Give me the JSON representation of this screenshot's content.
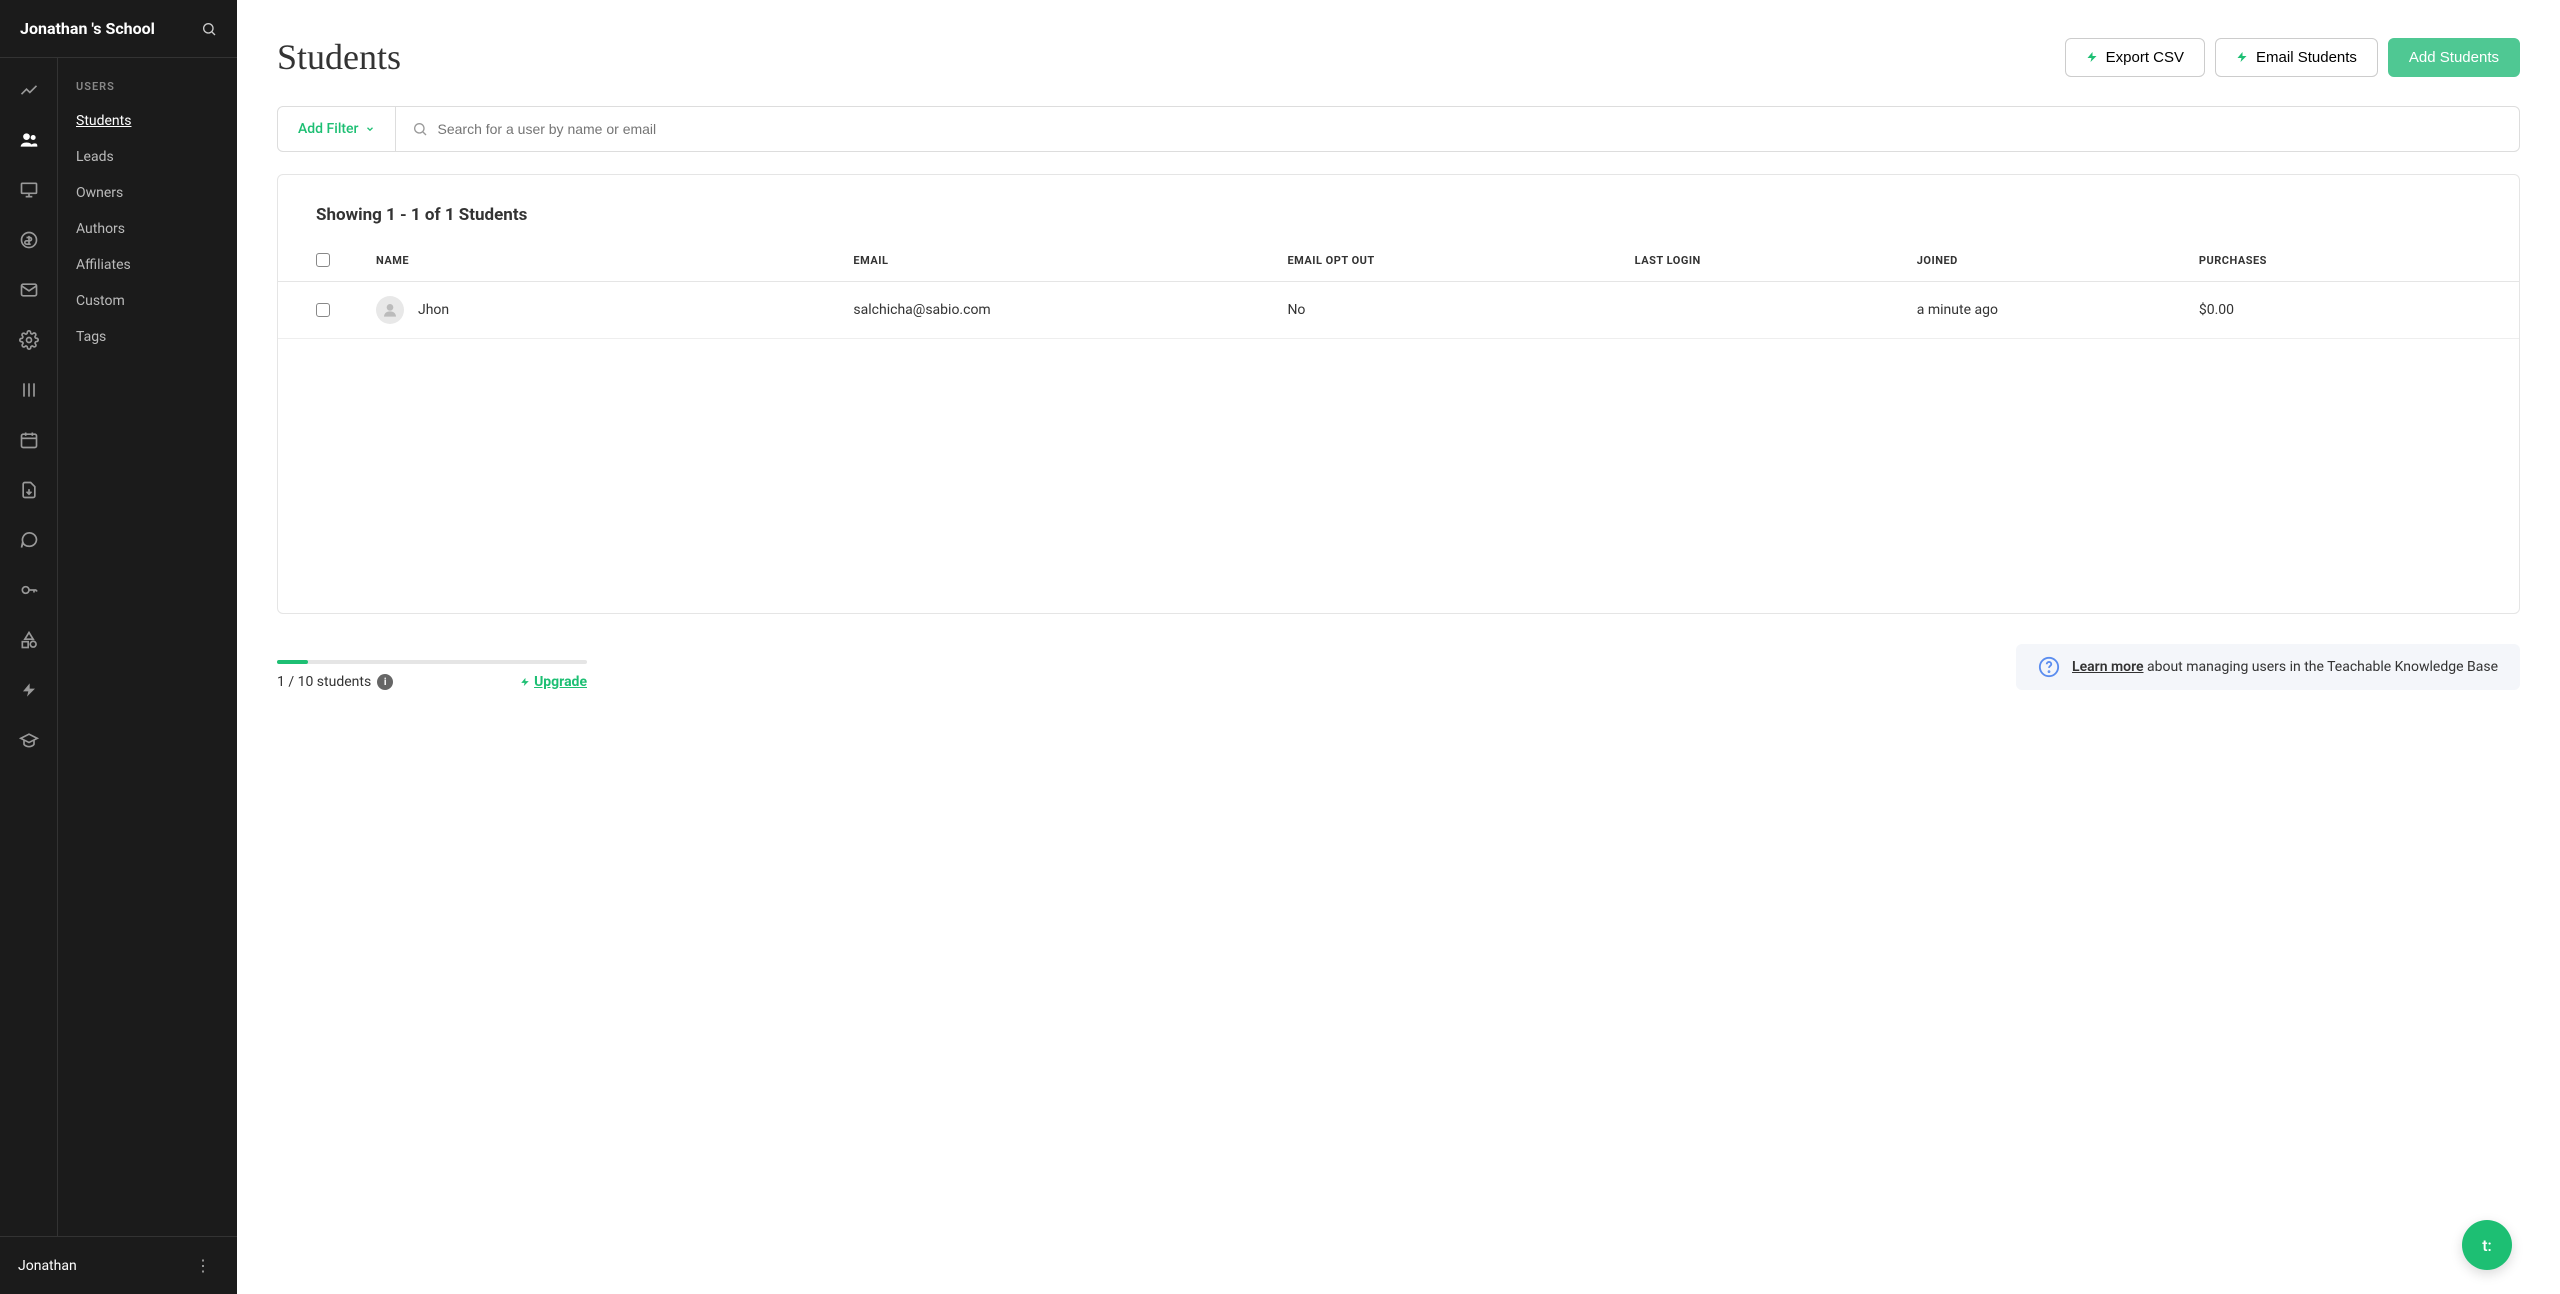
{
  "school_name": "Jonathan 's School",
  "subnav": {
    "heading": "USERS",
    "items": [
      "Students",
      "Leads",
      "Owners",
      "Authors",
      "Affiliates",
      "Custom",
      "Tags"
    ]
  },
  "user": {
    "name": "Jonathan"
  },
  "page": {
    "title": "Students",
    "actions": {
      "export_csv": "Export CSV",
      "email_students": "Email Students",
      "add_students": "Add Students"
    }
  },
  "filter": {
    "add_filter": "Add Filter",
    "search_placeholder": "Search for a user by name or email"
  },
  "table": {
    "summary": "Showing 1 - 1 of 1 Students",
    "columns": {
      "name": "NAME",
      "email": "EMAIL",
      "email_opt_out": "EMAIL OPT OUT",
      "last_login": "LAST LOGIN",
      "joined": "JOINED",
      "purchases": "PURCHASES"
    },
    "rows": [
      {
        "name": "Jhon",
        "email": "salchicha@sabio.com",
        "email_opt_out": "No",
        "last_login": "",
        "joined": "a minute ago",
        "purchases": "$0.00"
      }
    ]
  },
  "quota": {
    "text": "1 / 10 students",
    "upgrade": "Upgrade",
    "progress_percent": 10
  },
  "help": {
    "learn_more": "Learn more",
    "text": " about managing users in the Teachable Knowledge Base"
  },
  "fab_label": "t:"
}
